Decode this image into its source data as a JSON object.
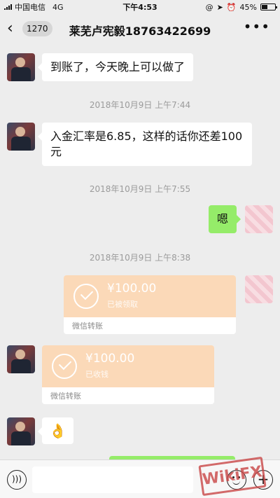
{
  "status_bar": {
    "carrier": "中国电信",
    "network": "4G",
    "time": "下午4:53",
    "battery": "45%",
    "battery_level": 0.45
  },
  "nav": {
    "back_icon": "chevron-left-icon",
    "unread_count": "1270",
    "title": "莱芜卢宪毅18763422699",
    "more_icon": "ellipsis-icon"
  },
  "messages": [
    {
      "type": "text",
      "side": "left",
      "text": "到账了，今天晚上可以做了"
    },
    {
      "type": "timestamp",
      "text": "2018年10月9日 上午7:44"
    },
    {
      "type": "text",
      "side": "left",
      "text": "入金汇率是6.85，这样的话你还差100元"
    },
    {
      "type": "timestamp",
      "text": "2018年10月9日 上午7:55"
    },
    {
      "type": "text",
      "side": "right",
      "text": "嗯"
    },
    {
      "type": "timestamp",
      "text": "2018年10月9日 上午8:38"
    },
    {
      "type": "transfer",
      "side": "right",
      "amount": "¥100.00",
      "status": "已被领取",
      "label": "微信转账"
    },
    {
      "type": "transfer",
      "side": "left",
      "amount": "¥100.00",
      "status": "已收钱",
      "label": "微信转账"
    },
    {
      "type": "emoji",
      "side": "left",
      "text": "👌"
    }
  ],
  "input_bar": {
    "voice_icon": "voice-icon",
    "emoji_icon": "emoji-icon",
    "plus_icon": "plus-icon"
  },
  "watermark": "WikiFX",
  "colors": {
    "my_bubble": "#95ec69",
    "transfer": "#fbd9b8",
    "background": "#ededed"
  }
}
